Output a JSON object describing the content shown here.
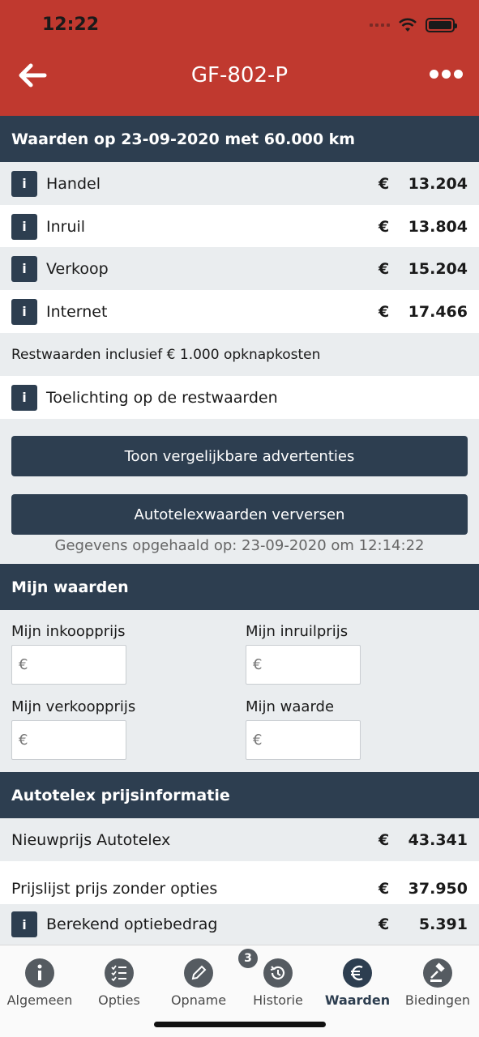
{
  "status": {
    "time": "12:22"
  },
  "header": {
    "title": "GF-802-P"
  },
  "values_section": {
    "title": "Waarden op 23-09-2020 met 60.000 km",
    "rows": [
      {
        "label": "Handel",
        "currency": "€",
        "value": "13.204"
      },
      {
        "label": "Inruil",
        "currency": "€",
        "value": "13.804"
      },
      {
        "label": "Verkoop",
        "currency": "€",
        "value": "15.204"
      },
      {
        "label": "Internet",
        "currency": "€",
        "value": "17.466"
      }
    ],
    "note": "Restwaarden inclusief € 1.000 opknapkosten",
    "explanation": "Toelichting op de restwaarden",
    "info_glyph": "i"
  },
  "buttons": {
    "show_ads": "Toon vergelijkbare advertenties",
    "refresh": "Autotelexwaarden verversen"
  },
  "fetched_text": "Gegevens opgehaald op: 23-09-2020 om 12:14:22",
  "my_values": {
    "title": "Mijn waarden",
    "fields": [
      {
        "label": "Mijn inkoopprijs",
        "placeholder": "€"
      },
      {
        "label": "Mijn inruilprijs",
        "placeholder": "€"
      },
      {
        "label": "Mijn verkoopprijs",
        "placeholder": "€"
      },
      {
        "label": "Mijn waarde",
        "placeholder": "€"
      }
    ]
  },
  "price_info": {
    "title": "Autotelex prijsinformatie",
    "rows": [
      {
        "label": "Nieuwprijs Autotelex",
        "currency": "€",
        "value": "43.341"
      },
      {
        "label": "Prijslijst prijs zonder opties",
        "currency": "€",
        "value": "37.950"
      },
      {
        "label": "Berekend optiebedrag",
        "currency": "€",
        "value": "5.391"
      }
    ]
  },
  "tabs": [
    {
      "label": "Algemeen",
      "icon": "info-icon"
    },
    {
      "label": "Opties",
      "icon": "checklist-icon"
    },
    {
      "label": "Opname",
      "icon": "pencil-icon"
    },
    {
      "label": "Historie",
      "icon": "history-icon",
      "badge": "3"
    },
    {
      "label": "Waarden",
      "icon": "euro-icon",
      "active": true
    },
    {
      "label": "Biedingen",
      "icon": "gavel-icon"
    }
  ],
  "colors": {
    "header_red": "#c0392f",
    "navy": "#2d3e50",
    "grey_row": "#eaedef"
  }
}
